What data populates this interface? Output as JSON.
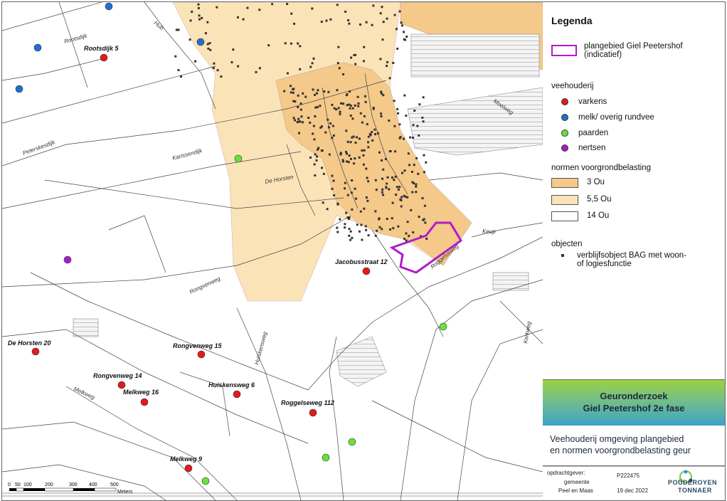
{
  "legend": {
    "title": "Legenda",
    "plan_label_1": "plangebied Giel Peetershof",
    "plan_label_2": "(indicatief)",
    "livestock_heading": "veehouderij",
    "livestock": [
      {
        "label": "varkens",
        "color": "#e31a1c"
      },
      {
        "label": "melk/ overig rundvee",
        "color": "#1f6fd1"
      },
      {
        "label": "paarden",
        "color": "#66e33a"
      },
      {
        "label": "nertsen",
        "color": "#a020c8"
      }
    ],
    "norms_heading": "normen voorgrondbelasting",
    "norms": [
      {
        "label": "3 Ou",
        "color": "#f4c98a"
      },
      {
        "label": "5,5 Ou",
        "color": "#fbe3b8"
      },
      {
        "label": "14 Ou",
        "color": "#ffffff"
      }
    ],
    "objects_heading": "objecten",
    "object_label_1": "verblijfsobject BAG met woon-",
    "object_label_2": "of logiesfunctie"
  },
  "title": {
    "line1": "Geuronderzoek",
    "line2": "Giel Peetershof 2e fase"
  },
  "subtitle": {
    "line1": "Veehouderij omgeving plangebied",
    "line2": "en normen voorgrondbelasting geur"
  },
  "footer": {
    "client_label": "opdrachtgever:",
    "client_1": "gemeente",
    "client_2": "Peel en Maas",
    "project_no": "P222475",
    "date": "19 dec 2022",
    "logo_1": "POUDEROYEN",
    "logo_2": "TONNAER"
  },
  "scale": {
    "ticks": [
      "0",
      "50",
      "100",
      "200",
      "300",
      "400",
      "500"
    ],
    "unit": "Meters"
  },
  "farms": [
    {
      "label": "Rootsdijk 5",
      "type": "varkens"
    },
    {
      "label": "Jacobusstraat 12",
      "type": "varkens"
    },
    {
      "label": "De Horsten 20",
      "type": "varkens"
    },
    {
      "label": "Rongvenweg 15",
      "type": "varkens"
    },
    {
      "label": "Rongvenweg 14",
      "type": "varkens"
    },
    {
      "label": "Melkweg 16",
      "type": "varkens"
    },
    {
      "label": "Huiskensweg 6",
      "type": "varkens"
    },
    {
      "label": "Roggelseweg 112",
      "type": "varkens"
    },
    {
      "label": "Melkweg 9",
      "type": "varkens"
    }
  ],
  "roads": [
    "Rootsdijk",
    "Peterskesdijk",
    "Karissendijk",
    "De Horsten",
    "Rongvenweg",
    "Huiskensweg",
    "Melkweg",
    "Roggelseweg",
    "Hub",
    "Keup",
    "Moelweg",
    "Kerkweg"
  ]
}
